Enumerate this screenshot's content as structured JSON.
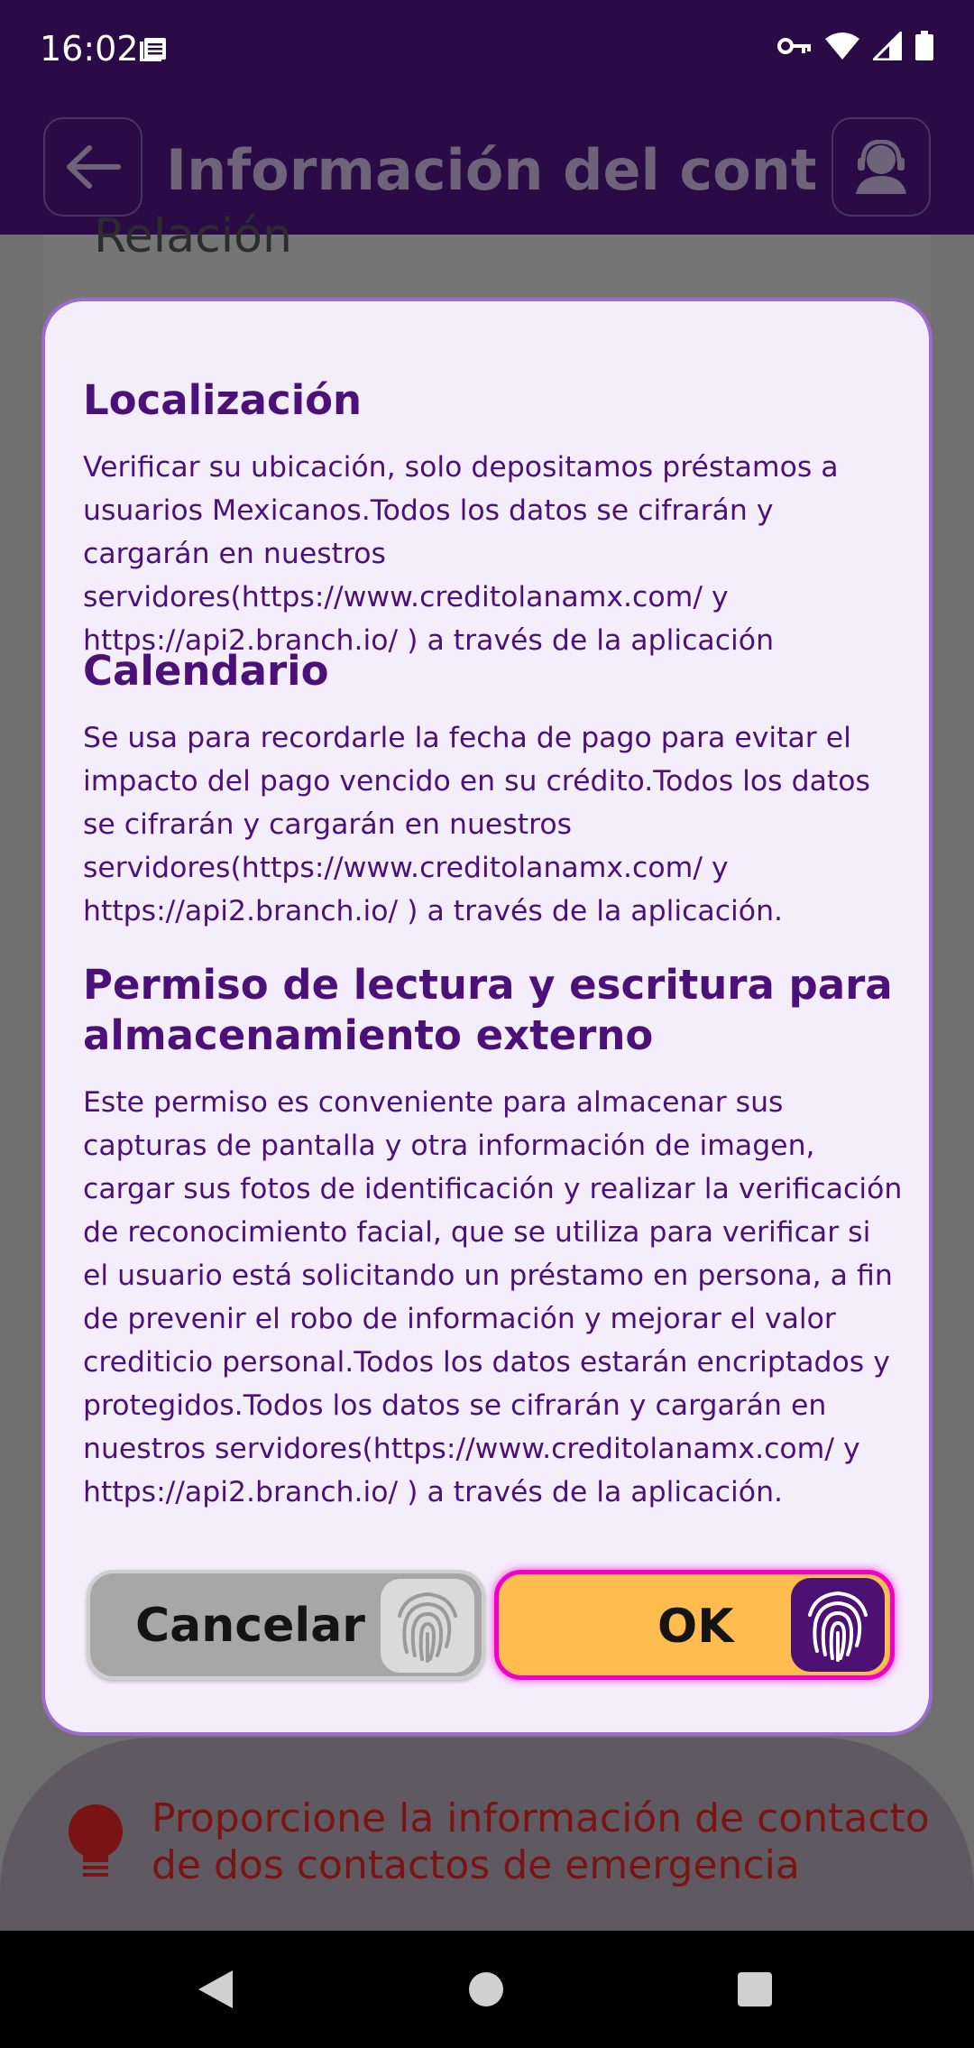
{
  "status_bar": {
    "time": "16:02",
    "icons": [
      "notification-icon",
      "key-icon",
      "wifi-icon",
      "signal-icon",
      "battery-icon"
    ]
  },
  "app_bar": {
    "title": "Información del contac..",
    "back_icon": "arrow-left-icon",
    "agent_icon": "customer-service-icon"
  },
  "background": {
    "field_label": "Relación",
    "notice_text": "Proporcione la información de contacto de dos contactos de emergencia",
    "notice_icon": "lightbulb-icon"
  },
  "dialog": {
    "sections": [
      {
        "title": "Localización",
        "body": "Verificar su ubicación, solo depositamos préstamos a usuarios Mexicanos.Todos los datos se cifrarán y cargarán en nuestros servidores(https://www.creditolanamx.com/ y https://api2.branch.io/ ) a través de la aplicación"
      },
      {
        "title": "Calendario",
        "body": "Se usa para recordarle la fecha de pago para evitar el impacto del pago vencido en su crédito.Todos los datos se cifrarán y cargarán en nuestros servidores(https://www.creditolanamx.com/ y https://api2.branch.io/ ) a través de la aplicación."
      },
      {
        "title": "Permiso de lectura y escritura para almacenamiento externo",
        "body": "Este permiso es conveniente para almacenar sus capturas de pantalla y otra información de imagen, cargar sus fotos de identificación y realizar la verificación de reconocimiento facial, que se utiliza para verificar si el usuario está solicitando un préstamo en persona, a fin de prevenir el robo de información y mejorar el valor crediticio personal.Todos los datos estarán encriptados y protegidos.Todos los datos se cifrarán y cargarán en nuestros servidores(https://www.creditolanamx.com/ y https://api2.branch.io/ ) a través de la aplicación."
      }
    ],
    "cancel_label": "Cancelar",
    "ok_label": "OK"
  },
  "colors": {
    "header_bg": "#2b0b46",
    "dialog_bg": "#f4eefc",
    "accent_purple": "#4b1178",
    "ok_button": "#ffbd4f",
    "ok_border": "#f000c8"
  }
}
